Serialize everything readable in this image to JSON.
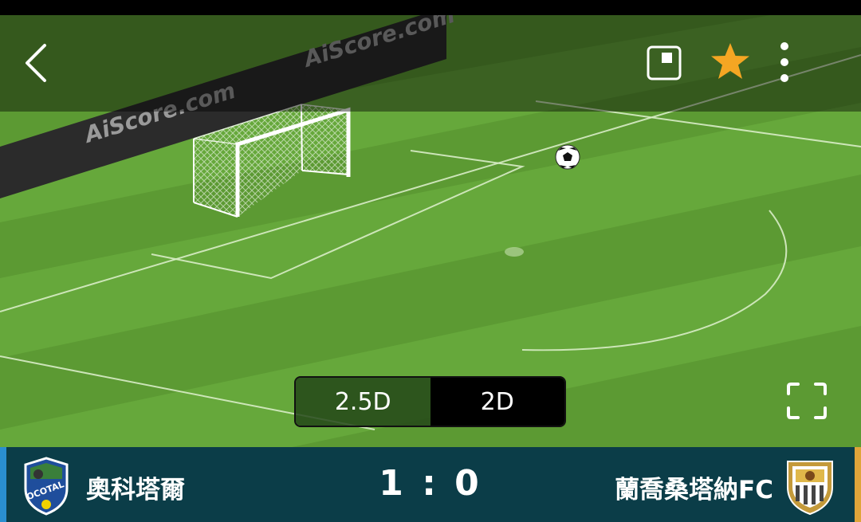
{
  "watermark": [
    "AiScore.com",
    "AiScore.com"
  ],
  "toolbar": {
    "back_icon": "chevron-left-icon",
    "pip_icon": "picture-in-picture-icon",
    "favorite_icon": "star-icon",
    "more_icon": "more-vertical-icon",
    "fullscreen_icon": "fullscreen-icon",
    "accent_color": "#f5a623"
  },
  "view_toggle": {
    "options": [
      "2.5D",
      "2D"
    ],
    "selected": "2D"
  },
  "match": {
    "home_team": "奧科塔爾",
    "away_team": "蘭喬桑塔納FC",
    "score": "1 : 0",
    "home_logo_text": "OCOTAL"
  },
  "colors": {
    "scorebar": "#0b3d48",
    "home_accent": "#2a8fd0",
    "away_accent": "#e0a53a",
    "pitch": "#5c9a33"
  }
}
